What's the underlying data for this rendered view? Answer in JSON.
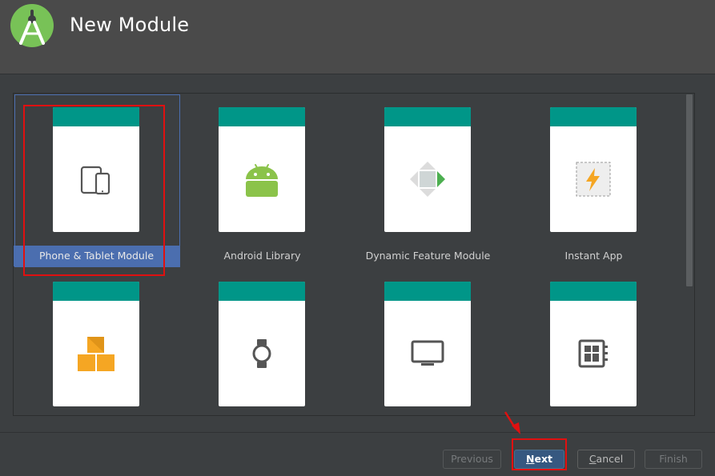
{
  "window": {
    "title": "New Module",
    "logo_icon": "android-studio-logo-icon"
  },
  "gallery": {
    "tiles": [
      {
        "label": "Phone & Tablet Module",
        "icon": "phone-tablet-icon",
        "selected": true
      },
      {
        "label": "Android Library",
        "icon": "android-robot-icon",
        "selected": false
      },
      {
        "label": "Dynamic Feature Module",
        "icon": "dynamic-feature-icon",
        "selected": false
      },
      {
        "label": "Instant App",
        "icon": "instant-app-icon",
        "selected": false
      },
      {
        "label": "",
        "icon": "java-library-blocks-icon",
        "selected": false
      },
      {
        "label": "",
        "icon": "wear-watch-icon",
        "selected": false
      },
      {
        "label": "",
        "icon": "tv-icon",
        "selected": false
      },
      {
        "label": "",
        "icon": "things-board-icon",
        "selected": false
      }
    ]
  },
  "buttons": {
    "previous": "Previous",
    "next_mnemonic": "N",
    "next_rest": "ext",
    "cancel_mnemonic": "C",
    "cancel_rest": "ancel",
    "finish": "Finish"
  },
  "colors": {
    "card_header": "#009688",
    "selection": "#4b6eaf",
    "primary_button": "#365880",
    "annotation_red": "#e01010"
  }
}
